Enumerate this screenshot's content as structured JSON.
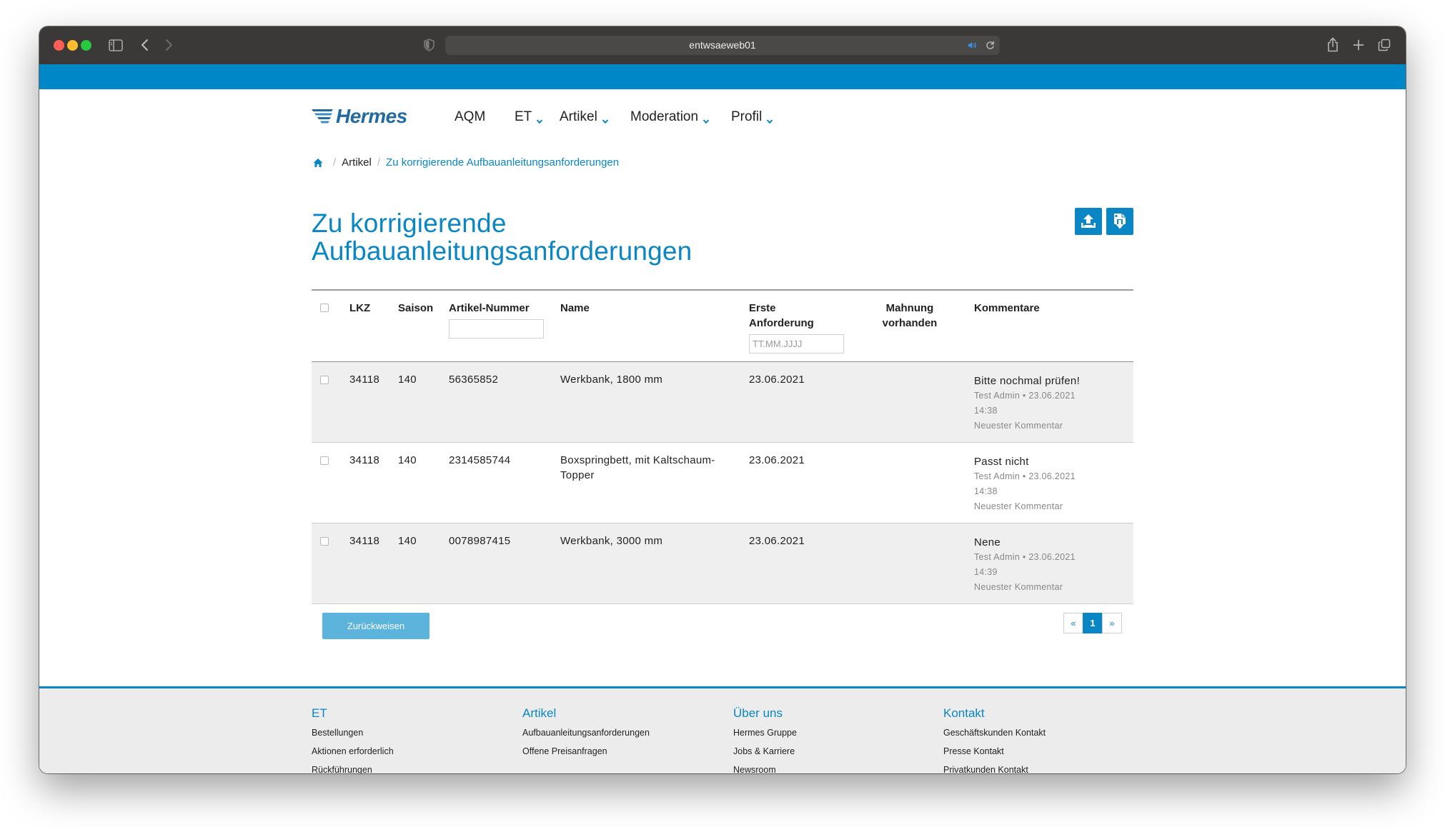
{
  "browser": {
    "url": "entwsaeweb01",
    "icons": [
      "sidebar-icon",
      "back-icon",
      "forward-icon",
      "shield-icon",
      "audio-icon",
      "reload-icon",
      "share-icon",
      "new-tab-icon",
      "tab-overview-icon"
    ]
  },
  "colors": {
    "accent": "#0a86c4",
    "top_bar": "#0087c7",
    "row_alt": "#efefef",
    "reject_button": "#5cb4dc",
    "logo": "#226a9f"
  },
  "header": {
    "logo_text": "Hermes",
    "nav": [
      {
        "label": "AQM",
        "has_dropdown": false
      },
      {
        "label": "ET",
        "has_dropdown": true
      },
      {
        "label": "Artikel",
        "has_dropdown": true
      },
      {
        "label": "Moderation",
        "has_dropdown": true
      },
      {
        "label": "Profil",
        "has_dropdown": true
      }
    ]
  },
  "breadcrumb": {
    "home_icon": "home-icon",
    "separator": "/",
    "items": [
      "Artikel",
      "Zu korrigierende Aufbauanleitungsanforderungen"
    ]
  },
  "page": {
    "title": "Zu korrigierende Aufbauanleitungsanforderungen",
    "action_icons": [
      "upload-icon",
      "download-document-icon"
    ]
  },
  "table": {
    "columns": {
      "lkz": "LKZ",
      "saison": "Saison",
      "artikel_nummer": "Artikel-Nummer",
      "name": "Name",
      "erste_anforderung": "Erste Anforderung",
      "mahnung": "Mahnung vorhanden",
      "kommentare": "Kommentare"
    },
    "filters": {
      "artikel_nummer": "",
      "erste_anforderung_placeholder": "TT.MM.JJJJ"
    },
    "rows": [
      {
        "lkz": "34118",
        "saison": "140",
        "artikel_nummer": "56365852",
        "name": "Werkbank, 1800 mm",
        "erste_anforderung": "23.06.2021",
        "mahnung": "",
        "comment": {
          "text": "Bitte nochmal prüfen!",
          "meta": "Test Admin • 23.06.2021 14:38",
          "label": "Neuester Kommentar"
        }
      },
      {
        "lkz": "34118",
        "saison": "140",
        "artikel_nummer": "2314585744",
        "name": "Boxspringbett, mit Kaltschaum-Topper",
        "erste_anforderung": "23.06.2021",
        "mahnung": "",
        "comment": {
          "text": "Passt nicht",
          "meta": "Test Admin • 23.06.2021 14:38",
          "label": "Neuester Kommentar"
        }
      },
      {
        "lkz": "34118",
        "saison": "140",
        "artikel_nummer": "0078987415",
        "name": "Werkbank, 3000 mm",
        "erste_anforderung": "23.06.2021",
        "mahnung": "",
        "comment": {
          "text": "Nene",
          "meta": "Test Admin • 23.06.2021 14:39",
          "label": "Neuester Kommentar"
        }
      }
    ]
  },
  "actions": {
    "reject_label": "Zurückweisen"
  },
  "pagination": {
    "prev": "«",
    "current": "1",
    "next": "»"
  },
  "footer": {
    "columns": [
      {
        "heading": "ET",
        "links": [
          "Bestellungen",
          "Aktionen erforderlich",
          "Rückführungen"
        ]
      },
      {
        "heading": "Artikel",
        "links": [
          "Aufbauanleitungsanforderungen",
          "Offene Preisanfragen"
        ]
      },
      {
        "heading": "Über uns",
        "links": [
          "Hermes Gruppe",
          "Jobs & Karriere",
          "Newsroom"
        ]
      },
      {
        "heading": "Kontakt",
        "links": [
          "Geschäftskunden Kontakt",
          "Presse Kontakt",
          "Privatkunden Kontakt"
        ]
      }
    ]
  }
}
